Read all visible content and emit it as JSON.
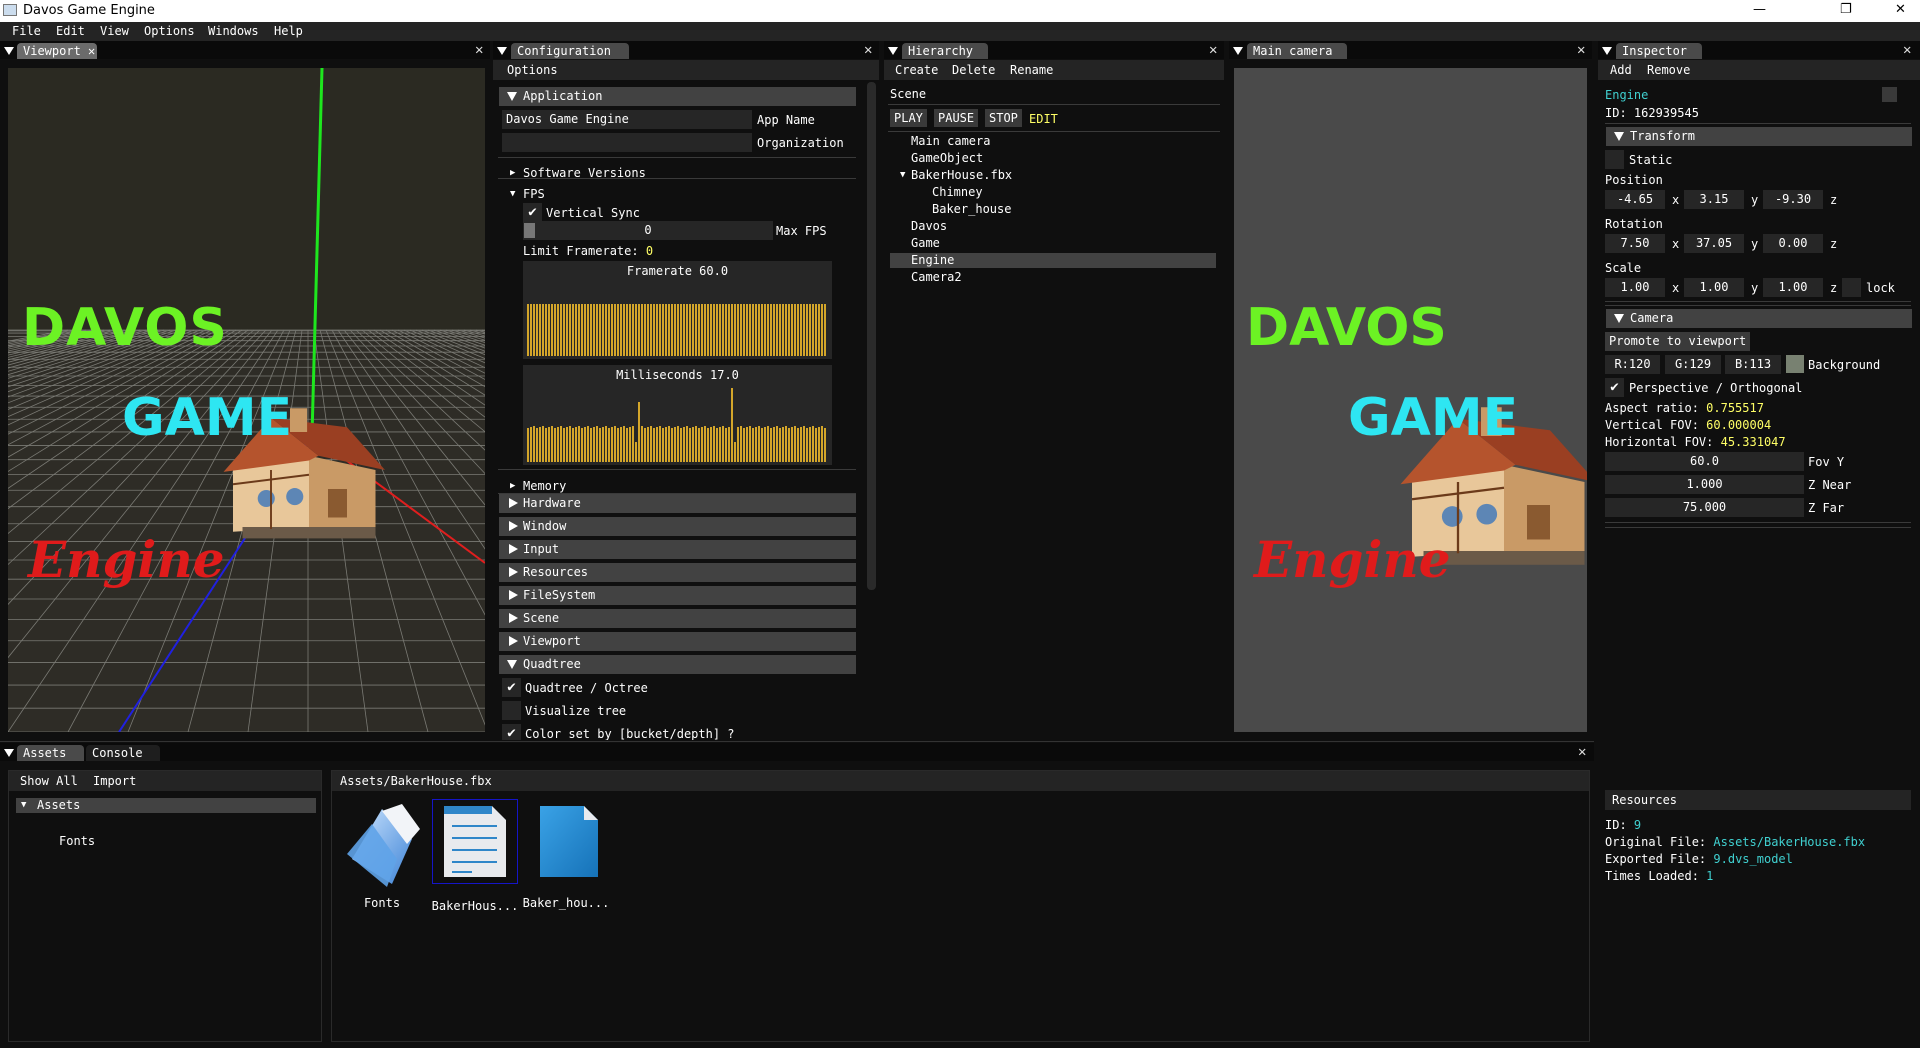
{
  "window": {
    "title": "Davos Game Engine",
    "minimize": "—",
    "maximize": "❐",
    "close": "✕"
  },
  "menu": [
    "File",
    "Edit",
    "View",
    "Options",
    "Windows",
    "Help"
  ],
  "viewport": {
    "tab": "Viewport",
    "overlay": {
      "line1": "DAVOS",
      "line2": "GAME",
      "line3": "Engine"
    }
  },
  "config": {
    "tab": "Configuration",
    "menu": "Options",
    "application": {
      "header": "Application",
      "app_name_value": "Davos Game Engine",
      "app_name_label": "App Name",
      "org_value": "",
      "org_label": "Organization"
    },
    "software_versions": "Software Versions",
    "fps": {
      "header": "FPS",
      "vsync": "Vertical Sync",
      "vsync_checked": true,
      "max_fps_value": "0",
      "max_fps_label": "Max FPS",
      "limit_label": "Limit Framerate:",
      "limit_value": "0",
      "framerate_title": "Framerate 60.0",
      "ms_title": "Milliseconds 17.0",
      "plot_color": "#d4a62a"
    },
    "sections": [
      "Memory",
      "Hardware",
      "Window",
      "Input",
      "Resources",
      "FileSystem",
      "Scene",
      "Viewport",
      "Quadtree"
    ],
    "quadtree": {
      "octree": "Quadtree / Octree",
      "octree_checked": true,
      "visualize": "Visualize tree",
      "visualize_checked": false,
      "color_set": "Color set by [bucket/depth] ?",
      "color_set_checked": true
    }
  },
  "hierarchy": {
    "tab": "Hierarchy",
    "menu": [
      "Create",
      "Delete",
      "Rename"
    ],
    "scene": "Scene",
    "controls": {
      "play": "PLAY",
      "pause": "PAUSE",
      "stop": "STOP",
      "state": "EDIT"
    },
    "items": [
      {
        "label": "Main camera",
        "depth": 0
      },
      {
        "label": "GameObject",
        "depth": 0
      },
      {
        "label": "BakerHouse.fbx",
        "depth": 0,
        "expanded": true
      },
      {
        "label": "Chimney",
        "depth": 1
      },
      {
        "label": "Baker_house",
        "depth": 1
      },
      {
        "label": "Davos",
        "depth": 0
      },
      {
        "label": "Game",
        "depth": 0
      },
      {
        "label": "Engine",
        "depth": 0,
        "selected": true
      },
      {
        "label": "Camera2",
        "depth": 0
      }
    ]
  },
  "main_camera": {
    "tab": "Main camera",
    "background": "#4a4a4a"
  },
  "inspector": {
    "tab": "Inspector",
    "menu": [
      "Add",
      "Remove"
    ],
    "name": "Engine",
    "id": "ID: 162939545",
    "transform": {
      "header": "Transform",
      "static": "Static",
      "position_label": "Position",
      "position": [
        "-4.65",
        "3.15",
        "-9.30"
      ],
      "rotation_label": "Rotation",
      "rotation": [
        "7.50",
        "37.05",
        "0.00"
      ],
      "scale_label": "Scale",
      "scale": [
        "1.00",
        "1.00",
        "1.00"
      ],
      "axes": [
        "x",
        "y",
        "z"
      ],
      "lock": "lock"
    },
    "camera": {
      "header": "Camera",
      "promote": "Promote to viewport",
      "r": "R:120",
      "g": "G:129",
      "b": "B:113",
      "bg_label": "Background",
      "bg_color": "#788171",
      "perspective": "Perspective / Orthogonal",
      "aspect_label": "Aspect ratio:",
      "aspect": "0.755517",
      "vfov_label": "Vertical FOV:",
      "vfov": "60.000004",
      "hfov_label": "Horizontal FOV:",
      "hfov": "45.331047",
      "fovy": "60.0",
      "fovy_label": "Fov Y",
      "znear": "1.000",
      "znear_label": "Z Near",
      "zfar": "75.000",
      "zfar_label": "Z Far"
    },
    "resources": {
      "header": "Resources",
      "id_label": "ID:",
      "id": "9",
      "orig_label": "Original File:",
      "orig": "Assets/BakerHouse.fbx",
      "exp_label": "Exported File:",
      "exp": "9.dvs_model",
      "loaded_label": "Times Loaded:",
      "loaded": "1"
    }
  },
  "bottom": {
    "tabs": [
      "Assets",
      "Console"
    ],
    "menu": [
      "Show All",
      "Import"
    ],
    "tree_root": "Assets",
    "tree_child": "Fonts",
    "path": "Assets/BakerHouse.fbx",
    "files": [
      {
        "label": "Fonts",
        "icon": "folder-icon"
      },
      {
        "label": "BakerHous...",
        "icon": "document-icon",
        "selected": true
      },
      {
        "label": "Baker_hou...",
        "icon": "mesh-file-icon"
      }
    ]
  }
}
